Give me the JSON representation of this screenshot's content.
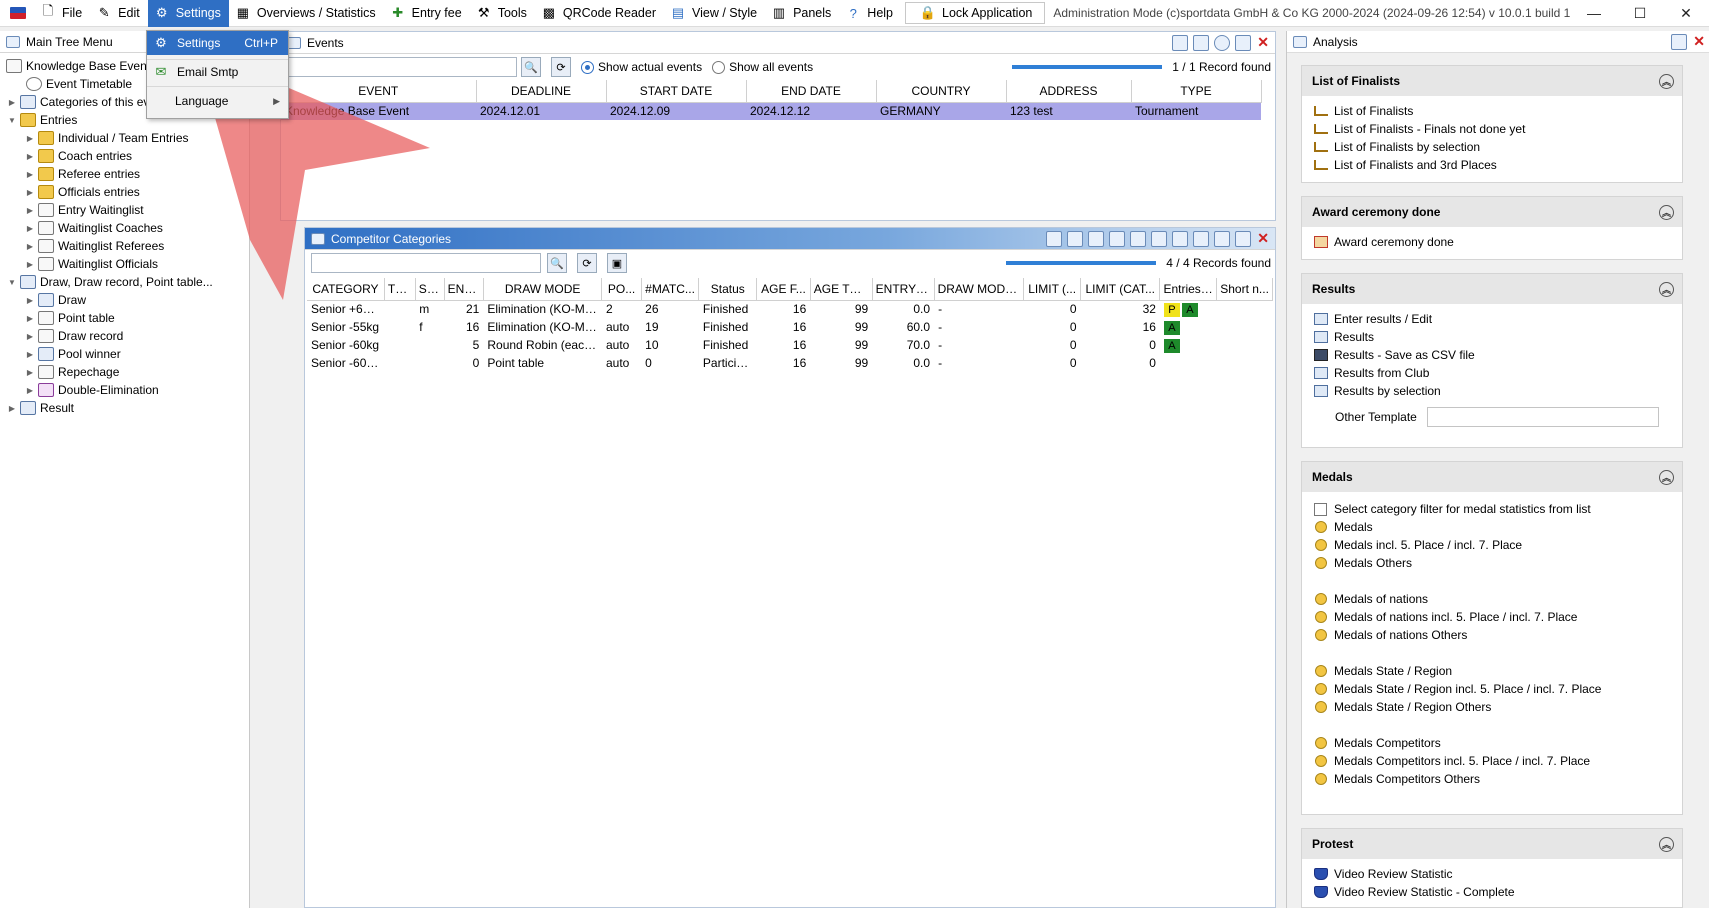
{
  "menubar": {
    "items": [
      {
        "label": "File",
        "icon": "file-icon"
      },
      {
        "label": "Edit",
        "icon": "edit-icon"
      },
      {
        "label": "Settings",
        "icon": "gear-icon"
      },
      {
        "label": "Overviews / Statistics",
        "icon": "statistics-icon"
      },
      {
        "label": "Entry fee",
        "icon": "money-icon"
      },
      {
        "label": "Tools",
        "icon": "wrench-icon"
      },
      {
        "label": "QRCode Reader",
        "icon": "qrcode-icon"
      },
      {
        "label": "View / Style",
        "icon": "view-icon"
      },
      {
        "label": "Panels",
        "icon": "panels-icon"
      },
      {
        "label": "Help",
        "icon": "help-icon"
      }
    ],
    "lock_label": "Lock Application",
    "title": "Administration Mode (c)sportdata GmbH & Co KG 2000-2024 (2024-09-26 12:54)  v 10.0.1 build 1 (2023-..."
  },
  "settings_menu": {
    "items": [
      {
        "label": "Settings",
        "shortcut": "Ctrl+P"
      },
      {
        "label": "Email Smtp",
        "shortcut": ""
      },
      {
        "label": "Language",
        "shortcut": ""
      }
    ]
  },
  "tree": {
    "title": "Main Tree Menu",
    "nodes": [
      {
        "label": "Knowledge Base Event"
      },
      {
        "label": "Event Timetable"
      },
      {
        "label": "Categories of this event"
      },
      {
        "label": "Entries"
      },
      {
        "label": "Individual / Team Entries"
      },
      {
        "label": "Coach entries"
      },
      {
        "label": "Referee entries"
      },
      {
        "label": "Officials entries"
      },
      {
        "label": "Entry Waitinglist"
      },
      {
        "label": "Waitinglist Coaches"
      },
      {
        "label": "Waitinglist Referees"
      },
      {
        "label": "Waitinglist Officials"
      },
      {
        "label": "Draw, Draw record, Point table..."
      },
      {
        "label": "Draw"
      },
      {
        "label": "Point table"
      },
      {
        "label": "Draw record"
      },
      {
        "label": "Pool winner"
      },
      {
        "label": "Repechage"
      },
      {
        "label": "Double-Elimination"
      },
      {
        "label": "Result"
      }
    ]
  },
  "events": {
    "title": "Events",
    "radio_actual": "Show actual events",
    "radio_all": "Show all events",
    "progress": 1.0,
    "progress_label": "100%",
    "records": "1 / 1 Record found",
    "columns": [
      "EVENT",
      "DEADLINE",
      "START DATE",
      "END DATE",
      "COUNTRY",
      "ADDRESS",
      "TYPE"
    ],
    "rows": [
      [
        "Knowledge Base Event",
        "2024.12.01",
        "2024.12.09",
        "2024.12.12",
        "GERMANY",
        "123 test",
        "Tournament"
      ]
    ]
  },
  "categories": {
    "title": "Competitor Categories",
    "progress": 1.0,
    "progress_label": "100%",
    "records": "4 / 4 Records found",
    "columns": [
      "CATEGORY",
      "TE...",
      "SEX",
      "ENT...",
      "DRAW MODE",
      "PO...",
      "#MATC...",
      "Status",
      "AGE F...",
      "AGE TO...",
      "ENTRY F...",
      "DRAW MODE...",
      "LIMIT (...",
      "LIMIT (CAT...",
      "Entries ...",
      "Short n..."
    ],
    "rows": [
      [
        "Senior +65kg",
        "",
        "m",
        "21",
        "Elimination (KO-Mo...",
        "2",
        "26",
        "Finished",
        "16",
        "99",
        "0.0",
        "-",
        "0",
        "32",
        "P|A",
        ""
      ],
      [
        "Senior -55kg",
        "",
        "f",
        "16",
        "Elimination (KO-Mo...",
        "auto",
        "19",
        "Finished",
        "16",
        "99",
        "60.0",
        "-",
        "0",
        "16",
        "A",
        ""
      ],
      [
        "Senior -60kg",
        "",
        "",
        "5",
        "Round Robin (each ...",
        "auto",
        "10",
        "Finished",
        "16",
        "99",
        "70.0",
        "-",
        "0",
        "0",
        "A",
        ""
      ],
      [
        "Senior -60k...",
        "",
        "",
        "0",
        "Point table",
        "auto",
        "0",
        "Particip...",
        "16",
        "99",
        "0.0",
        "-",
        "0",
        "0",
        "",
        ""
      ]
    ]
  },
  "analysis": {
    "title": "Analysis",
    "sections": [
      {
        "title": "List of Finalists",
        "items": [
          "List of Finalists",
          "List of Finalists - Finals not done yet",
          "List of Finalists by selection",
          "List of Finalists and 3rd Places"
        ]
      },
      {
        "title": "Award ceremony done",
        "items": [
          "Award ceremony done"
        ]
      },
      {
        "title": "Results",
        "items": [
          "Enter results / Edit",
          "Results",
          "Results - Save as CSV file",
          "Results from Club",
          "Results by selection"
        ],
        "other_template_label": "Other Template"
      },
      {
        "title": "Medals",
        "checkbox_label": "Select category filter for medal statistics from list",
        "items": [
          "Medals",
          "Medals incl. 5. Place / incl. 7. Place",
          "Medals Others",
          "Medals of nations",
          "Medals of nations incl. 5. Place / incl. 7. Place",
          "Medals of nations Others",
          "Medals State / Region",
          "Medals State / Region incl. 5. Place / incl. 7. Place",
          "Medals State / Region Others",
          "Medals Competitors",
          "Medals Competitors incl. 5. Place / incl. 7. Place",
          "Medals Competitors Others"
        ]
      },
      {
        "title": "Protest",
        "items": [
          "Video Review Statistic",
          "Video Review Statistic - Complete"
        ]
      }
    ]
  },
  "colors": {
    "accent": "#2f6fc4",
    "selected_row": "#a9a6e8",
    "badge_p": "#f0e21a",
    "badge_a": "#1e8a2b",
    "arrow": "#e85a5a"
  }
}
